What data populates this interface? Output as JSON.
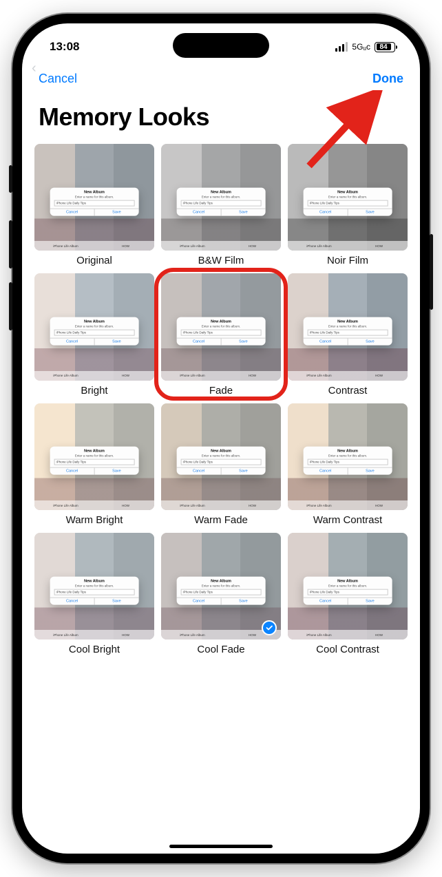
{
  "status": {
    "time": "13:08",
    "network": "5Gᵤᴄ",
    "battery": "84"
  },
  "nav": {
    "cancel": "Cancel",
    "done": "Done"
  },
  "title": "Memory Looks",
  "dialog": {
    "header": "New Album",
    "sub": "Enter a name for this album.",
    "field": "iPhone Life Daily Tips",
    "cancel": "Cancel",
    "save": "Save"
  },
  "strip": {
    "left": "iPhone Life Album",
    "right": "HOW"
  },
  "looks": [
    {
      "label": "Original",
      "filter": "",
      "highlighted": false,
      "selected": false
    },
    {
      "label": "B&W Film",
      "filter": "filter-bw",
      "highlighted": false,
      "selected": false
    },
    {
      "label": "Noir Film",
      "filter": "filter-noir",
      "highlighted": false,
      "selected": false
    },
    {
      "label": "Bright",
      "filter": "filter-bright",
      "highlighted": false,
      "selected": false
    },
    {
      "label": "Fade",
      "filter": "filter-fade",
      "highlighted": true,
      "selected": false
    },
    {
      "label": "Contrast",
      "filter": "filter-contrast",
      "highlighted": false,
      "selected": false
    },
    {
      "label": "Warm Bright",
      "filter": "filter-wbright",
      "highlighted": false,
      "selected": false
    },
    {
      "label": "Warm Fade",
      "filter": "filter-wfade",
      "highlighted": false,
      "selected": false
    },
    {
      "label": "Warm Contrast",
      "filter": "filter-wcontrast",
      "highlighted": false,
      "selected": false
    },
    {
      "label": "Cool Bright",
      "filter": "filter-cbright",
      "highlighted": false,
      "selected": false
    },
    {
      "label": "Cool Fade",
      "filter": "filter-cfade",
      "highlighted": false,
      "selected": true
    },
    {
      "label": "Cool Contrast",
      "filter": "filter-ccontrast",
      "highlighted": false,
      "selected": false
    }
  ],
  "annotation": {
    "color": "#e2231a"
  }
}
